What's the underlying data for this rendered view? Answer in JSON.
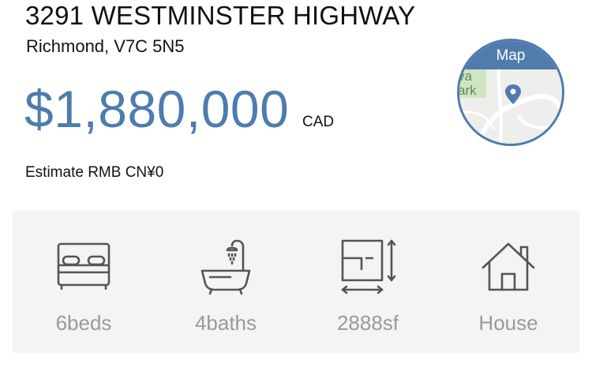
{
  "listing": {
    "address": "3291 WESTMINSTER HIGHWAY",
    "city_postal": "Richmond, V7C 5N5",
    "price": "$1,880,000",
    "currency": "CAD",
    "estimate": "Estimate RMB CN¥0"
  },
  "map": {
    "label": "Map",
    "park_text": "va\nark",
    "icon": "location-pin-icon"
  },
  "features": [
    {
      "icon": "bed-icon",
      "label": "6beds"
    },
    {
      "icon": "bathtub-icon",
      "label": "4baths"
    },
    {
      "icon": "floor-plan-icon",
      "label": "2888sf"
    },
    {
      "icon": "house-icon",
      "label": "House"
    }
  ],
  "colors": {
    "price_blue": "#4d7cae",
    "map_blue": "#4f7bad",
    "feature_text": "#9a9a9a",
    "icon_stroke": "#555555",
    "panel_bg": "#f4f4f4",
    "park_green": "#cfe6c4"
  }
}
